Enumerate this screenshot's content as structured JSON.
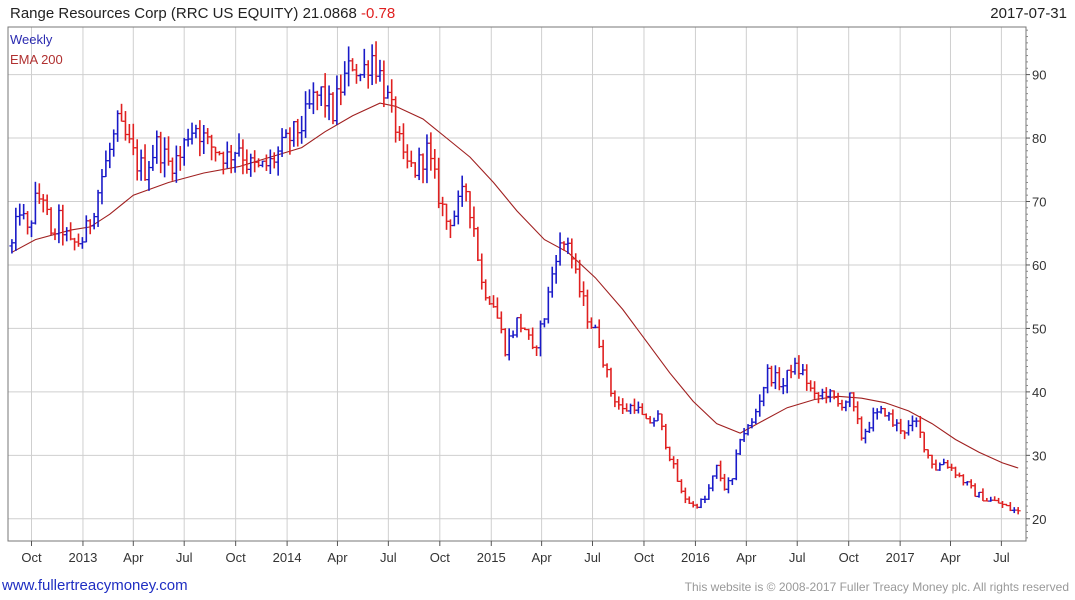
{
  "header": {
    "title": "Range Resources Corp (RRC US EQUITY) 21.0868",
    "change": "-0.78",
    "date": "2017-07-31"
  },
  "footer": {
    "site": "www.fullertreacymoney.com",
    "copyright": "This website is © 2008-2017 Fuller Treacy Money plc. All rights reserved"
  },
  "colors": {
    "up": "#1a1ac8",
    "down": "#e02020",
    "ema": "#a02020",
    "grid": "#cfcfcf",
    "site_link": "#1f2ec2"
  },
  "chart_data": {
    "type": "ohlc",
    "legend": [
      "Weekly",
      "EMA 200"
    ],
    "legend_position": "top-left",
    "y_axis_side": "right",
    "ylim": [
      16.5,
      97.5
    ],
    "yticks": [
      20,
      30,
      40,
      50,
      60,
      70,
      80,
      90
    ],
    "xlim": [
      "2012-08-20",
      "2017-08-14"
    ],
    "x_labels": [
      {
        "label": "Oct",
        "date": "2012-10-01"
      },
      {
        "label": "2013",
        "date": "2013-01-01"
      },
      {
        "label": "Apr",
        "date": "2013-04-01"
      },
      {
        "label": "Jul",
        "date": "2013-07-01"
      },
      {
        "label": "Oct",
        "date": "2013-10-01"
      },
      {
        "label": "2014",
        "date": "2014-01-01"
      },
      {
        "label": "Apr",
        "date": "2014-04-01"
      },
      {
        "label": "Jul",
        "date": "2014-07-01"
      },
      {
        "label": "Oct",
        "date": "2014-10-01"
      },
      {
        "label": "2015",
        "date": "2015-01-01"
      },
      {
        "label": "Apr",
        "date": "2015-04-01"
      },
      {
        "label": "Jul",
        "date": "2015-07-01"
      },
      {
        "label": "Oct",
        "date": "2015-10-01"
      },
      {
        "label": "2016",
        "date": "2016-01-01"
      },
      {
        "label": "Apr",
        "date": "2016-04-01"
      },
      {
        "label": "Jul",
        "date": "2016-07-01"
      },
      {
        "label": "Oct",
        "date": "2016-10-01"
      },
      {
        "label": "2017",
        "date": "2017-01-01"
      },
      {
        "label": "Apr",
        "date": "2017-04-01"
      },
      {
        "label": "Jul",
        "date": "2017-07-01"
      }
    ],
    "price_path": [
      [
        "2012-08-27",
        63
      ],
      [
        "2012-09-10",
        69
      ],
      [
        "2012-09-24",
        65
      ],
      [
        "2012-10-08",
        70
      ],
      [
        "2012-10-22",
        71
      ],
      [
        "2012-11-05",
        64
      ],
      [
        "2012-11-19",
        67
      ],
      [
        "2012-12-10",
        63
      ],
      [
        "2012-12-31",
        64
      ],
      [
        "2013-01-14",
        67
      ],
      [
        "2013-02-04",
        74
      ],
      [
        "2013-02-18",
        78
      ],
      [
        "2013-03-04",
        82
      ],
      [
        "2013-03-18",
        80
      ],
      [
        "2013-04-08",
        76
      ],
      [
        "2013-04-22",
        75
      ],
      [
        "2013-05-13",
        79
      ],
      [
        "2013-06-03",
        76
      ],
      [
        "2013-06-24",
        77
      ],
      [
        "2013-07-08",
        81
      ],
      [
        "2013-07-22",
        82
      ],
      [
        "2013-08-12",
        79
      ],
      [
        "2013-09-02",
        78
      ],
      [
        "2013-09-16",
        77
      ],
      [
        "2013-10-07",
        79
      ],
      [
        "2013-10-21",
        76
      ],
      [
        "2013-11-11",
        75
      ],
      [
        "2013-12-02",
        76
      ],
      [
        "2014-01-06",
        80
      ],
      [
        "2014-01-27",
        82
      ],
      [
        "2014-02-17",
        86
      ],
      [
        "2014-03-03",
        87
      ],
      [
        "2014-03-24",
        84
      ],
      [
        "2014-04-07",
        88
      ],
      [
        "2014-04-28",
        92
      ],
      [
        "2014-05-12",
        90
      ],
      [
        "2014-06-02",
        93
      ],
      [
        "2014-06-16",
        90
      ],
      [
        "2014-06-30",
        86
      ],
      [
        "2014-07-14",
        82
      ],
      [
        "2014-07-28",
        76
      ],
      [
        "2014-08-18",
        75
      ],
      [
        "2014-09-08",
        78
      ],
      [
        "2014-09-29",
        71
      ],
      [
        "2014-10-13",
        67
      ],
      [
        "2014-10-27",
        68
      ],
      [
        "2014-11-17",
        72
      ],
      [
        "2014-12-01",
        66
      ],
      [
        "2014-12-15",
        57
      ],
      [
        "2015-01-05",
        54
      ],
      [
        "2015-01-26",
        47
      ],
      [
        "2015-02-16",
        51
      ],
      [
        "2015-03-02",
        50
      ],
      [
        "2015-03-16",
        46
      ],
      [
        "2015-04-06",
        52
      ],
      [
        "2015-04-27",
        62
      ],
      [
        "2015-05-18",
        64
      ],
      [
        "2015-06-01",
        58
      ],
      [
        "2015-06-22",
        52
      ],
      [
        "2015-07-13",
        48
      ],
      [
        "2015-08-03",
        40
      ],
      [
        "2015-08-24",
        37
      ],
      [
        "2015-09-14",
        38
      ],
      [
        "2015-10-05",
        35
      ],
      [
        "2015-10-26",
        36
      ],
      [
        "2015-11-16",
        30
      ],
      [
        "2015-12-07",
        24
      ],
      [
        "2015-12-28",
        22
      ],
      [
        "2016-01-18",
        23
      ],
      [
        "2016-02-08",
        28
      ],
      [
        "2016-02-22",
        25
      ],
      [
        "2016-03-07",
        26
      ],
      [
        "2016-03-21",
        33
      ],
      [
        "2016-04-11",
        35
      ],
      [
        "2016-04-25",
        39
      ],
      [
        "2016-05-09",
        43
      ],
      [
        "2016-06-06",
        41
      ],
      [
        "2016-06-20",
        44
      ],
      [
        "2016-07-11",
        43
      ],
      [
        "2016-08-01",
        39
      ],
      [
        "2016-08-22",
        40
      ],
      [
        "2016-09-12",
        38
      ],
      [
        "2016-10-03",
        39
      ],
      [
        "2016-10-24",
        33
      ],
      [
        "2016-11-14",
        36
      ],
      [
        "2016-12-05",
        37
      ],
      [
        "2016-12-19",
        35
      ],
      [
        "2017-01-09",
        34
      ],
      [
        "2017-01-30",
        35
      ],
      [
        "2017-02-20",
        30
      ],
      [
        "2017-03-06",
        28
      ],
      [
        "2017-03-20",
        29
      ],
      [
        "2017-04-03",
        28
      ],
      [
        "2017-04-24",
        26
      ],
      [
        "2017-05-15",
        24
      ],
      [
        "2017-06-05",
        23
      ],
      [
        "2017-06-26",
        22.5
      ],
      [
        "2017-07-17",
        21.5
      ],
      [
        "2017-07-31",
        21.1
      ]
    ],
    "ema_200": [
      [
        "2012-08-27",
        62
      ],
      [
        "2012-10-08",
        64
      ],
      [
        "2012-12-10",
        65.5
      ],
      [
        "2013-01-14",
        66
      ],
      [
        "2013-02-18",
        68
      ],
      [
        "2013-04-01",
        71
      ],
      [
        "2013-06-03",
        73
      ],
      [
        "2013-08-05",
        74.5
      ],
      [
        "2013-10-07",
        75.5
      ],
      [
        "2013-12-02",
        77
      ],
      [
        "2014-01-27",
        78.5
      ],
      [
        "2014-03-10",
        81
      ],
      [
        "2014-04-28",
        83.5
      ],
      [
        "2014-06-16",
        85.5
      ],
      [
        "2014-07-14",
        85
      ],
      [
        "2014-09-01",
        83
      ],
      [
        "2014-10-13",
        80
      ],
      [
        "2014-11-24",
        77
      ],
      [
        "2015-01-05",
        73
      ],
      [
        "2015-02-16",
        68.5
      ],
      [
        "2015-04-06",
        64
      ],
      [
        "2015-05-18",
        62
      ],
      [
        "2015-07-06",
        58
      ],
      [
        "2015-08-24",
        53
      ],
      [
        "2015-10-05",
        48
      ],
      [
        "2015-11-16",
        43
      ],
      [
        "2015-12-28",
        38.5
      ],
      [
        "2016-02-08",
        35
      ],
      [
        "2016-03-21",
        33.5
      ],
      [
        "2016-05-02",
        35.5
      ],
      [
        "2016-06-13",
        37.5
      ],
      [
        "2016-08-01",
        38.8
      ],
      [
        "2016-09-12",
        39.3
      ],
      [
        "2016-10-24",
        39
      ],
      [
        "2016-12-05",
        38.3
      ],
      [
        "2017-01-16",
        37
      ],
      [
        "2017-02-27",
        35
      ],
      [
        "2017-04-10",
        32.5
      ],
      [
        "2017-05-22",
        30.5
      ],
      [
        "2017-07-03",
        28.8
      ],
      [
        "2017-07-31",
        28
      ]
    ]
  }
}
